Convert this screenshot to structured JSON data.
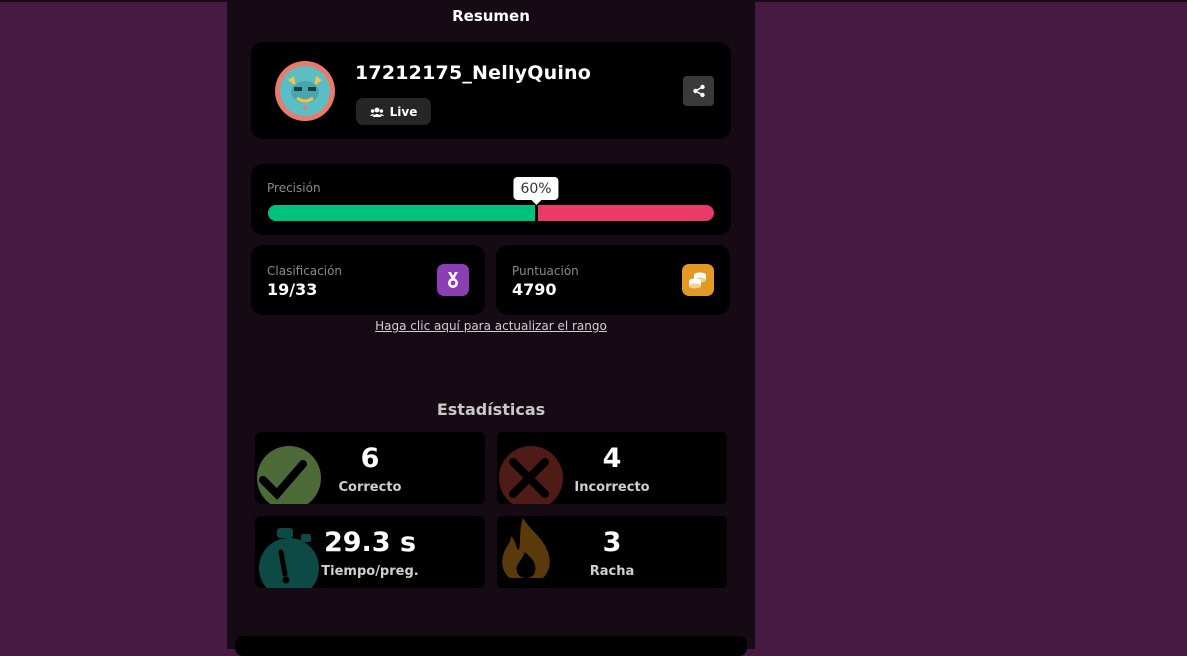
{
  "summary": {
    "title": "Resumen"
  },
  "player": {
    "name": "17212175_NellyQuino",
    "mode_label": "Live"
  },
  "precision": {
    "label": "Precisión",
    "percent_label": "60%",
    "value": 0.6
  },
  "ranking": {
    "label": "Clasificación",
    "value": "19/33",
    "icon": "medal-icon",
    "color": "#8b3fb2"
  },
  "score": {
    "label": "Puntuación",
    "value": "4790",
    "icon": "coins-icon",
    "color": "#e29a24"
  },
  "update_link": "Haga clic aquí para actualizar el rango",
  "stats": {
    "title": "Estadísticas",
    "correct": {
      "value": "6",
      "label": "Correcto",
      "icon": "checkmark-icon"
    },
    "incorrect": {
      "value": "4",
      "label": "Incorrecto",
      "icon": "cross-icon"
    },
    "time": {
      "value": "29.3 s",
      "label": "Tiempo/preg.",
      "icon": "stopwatch-icon"
    },
    "streak": {
      "value": "3",
      "label": "Racha",
      "icon": "flame-icon"
    }
  },
  "colors": {
    "background": "#461a42",
    "panel": "#160a14",
    "correct": "#00c27f",
    "incorrect": "#ea3a66"
  }
}
